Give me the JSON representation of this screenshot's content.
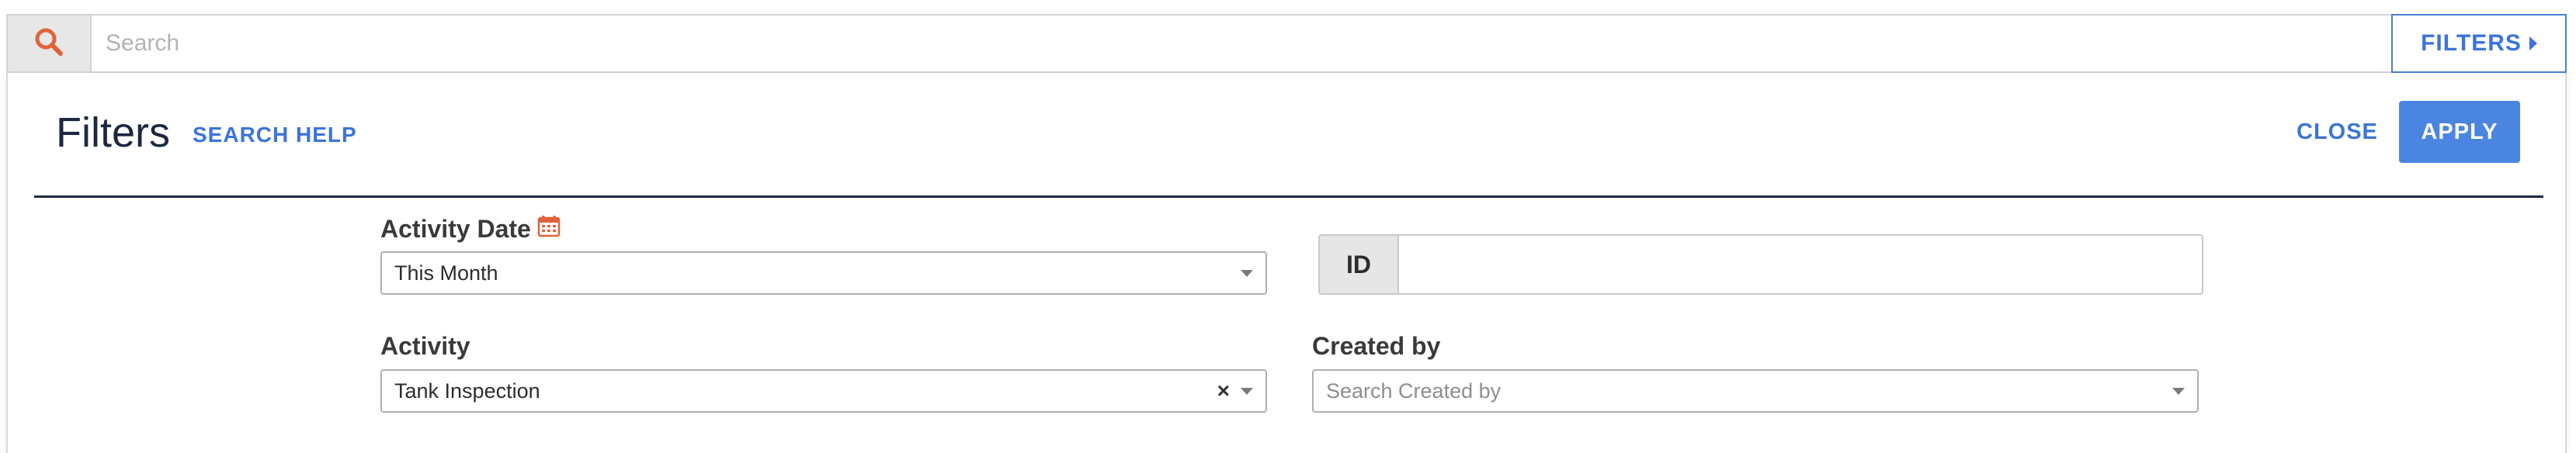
{
  "search": {
    "placeholder": "Search",
    "filters_toggle_label": "FILTERS"
  },
  "panel": {
    "title": "Filters",
    "search_help_label": "SEARCH HELP",
    "close_label": "CLOSE",
    "apply_label": "APPLY"
  },
  "fields": {
    "activity_date": {
      "label": "Activity Date",
      "value": "This Month"
    },
    "id": {
      "addon_label": "ID",
      "value": ""
    },
    "activity": {
      "label": "Activity",
      "value": "Tank Inspection",
      "clear_glyph": "×"
    },
    "created_by": {
      "label": "Created by",
      "placeholder": "Search Created by"
    }
  },
  "colors": {
    "accent": "#3b74d9",
    "apply_bg": "#4a86e0",
    "search_icon": "#e0633a",
    "calendar_icon": "#e0633a",
    "title_dark": "#1c2840"
  },
  "icons": {
    "search": "search-icon",
    "filters_caret": "caret-right-icon",
    "calendar": "calendar-icon",
    "dropdown": "chevron-down-icon"
  }
}
